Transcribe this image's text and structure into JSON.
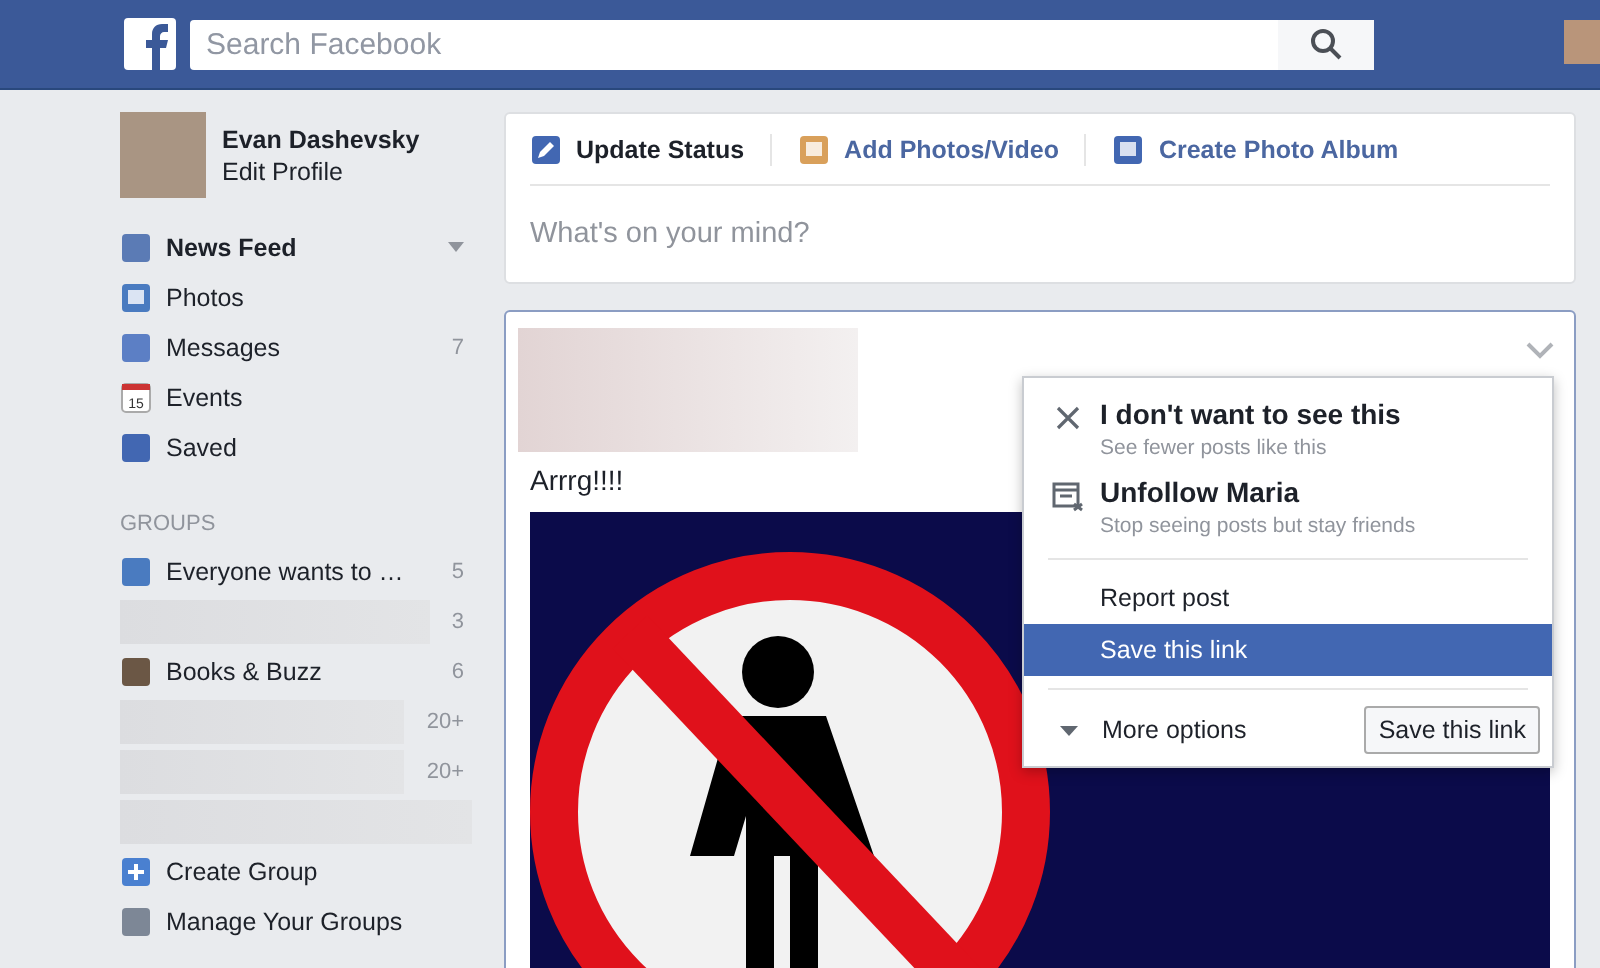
{
  "header": {
    "search": {
      "placeholder": "Search Facebook"
    }
  },
  "profile": {
    "name": "Evan Dashevsky",
    "link": "Edit Profile"
  },
  "nav": [
    {
      "label": "News Feed",
      "selected": true
    },
    {
      "label": "Photos",
      "selected": false
    },
    {
      "label": "Messages",
      "selected": false,
      "count": "7"
    },
    {
      "label": "Events",
      "selected": false,
      "icon_text": "15"
    },
    {
      "label": "Saved",
      "selected": false
    }
  ],
  "groups": {
    "heading": "GROUPS",
    "items": [
      {
        "kind": "group",
        "label": "Everyone wants to …",
        "count": "5"
      },
      {
        "kind": "blurred",
        "count": "3"
      },
      {
        "kind": "group",
        "label": "Books & Buzz",
        "count": "6"
      },
      {
        "kind": "blurred",
        "count": "20+"
      },
      {
        "kind": "blurred",
        "count": "20+"
      },
      {
        "kind": "blurred"
      },
      {
        "kind": "group",
        "label": "Create Group"
      },
      {
        "kind": "group",
        "label": "Manage Your Groups"
      }
    ]
  },
  "composer": {
    "tabs": [
      {
        "label": "Update Status",
        "selected": true
      },
      {
        "label": "Add Photos/Video",
        "selected": false
      },
      {
        "label": "Create Photo Album",
        "selected": false
      }
    ],
    "placeholder": "What's on your mind?"
  },
  "post": {
    "text": "Arrrg!!!!"
  },
  "menu": {
    "items": [
      {
        "kind": "rich",
        "title": "I don't want to see this",
        "subtitle": "See fewer posts like this",
        "selected": false
      },
      {
        "kind": "rich",
        "title": "Unfollow Maria",
        "subtitle": "Stop seeing posts but stay friends",
        "selected": false
      },
      {
        "kind": "plain",
        "title": "Report post",
        "selected": false
      },
      {
        "kind": "plain",
        "title": "Save this link",
        "selected": true
      }
    ],
    "more": "More options",
    "button": "Save this link"
  }
}
